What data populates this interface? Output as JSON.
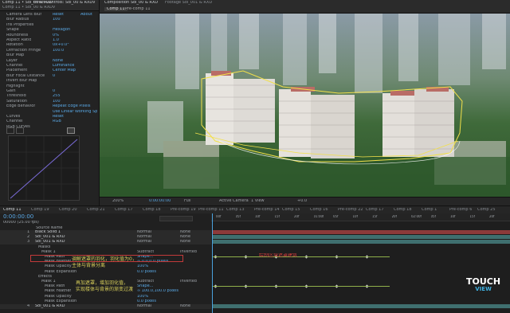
{
  "effect_controls": {
    "tabs": [
      "Comp 11 • Sol_00 & RXD",
      "Effect Controls: Sol_00 & RXDV"
    ],
    "header": "Comp 11 • Sol_00 & RXDV",
    "rows": [
      {
        "label": "Camera Lens Blur",
        "value": "Reset"
      },
      {
        "label": "Blur Radius",
        "value": "100"
      },
      {
        "label": "Iris Properties",
        "value": ""
      },
      {
        "label": "Shape",
        "value": "Hexagon"
      },
      {
        "label": "Roundness",
        "value": "0%"
      },
      {
        "label": "Aspect Ratio",
        "value": "1.0"
      },
      {
        "label": "Rotation",
        "value": "0x+0.0°"
      },
      {
        "label": "Diffraction Fringe",
        "value": "100.0"
      },
      {
        "label": "Blur Map",
        "value": ""
      },
      {
        "label": "Layer",
        "value": "None"
      },
      {
        "label": "Channel",
        "value": "Luminance"
      },
      {
        "label": "Placement",
        "value": "Center Map"
      },
      {
        "label": "Blur Focal Distance",
        "value": "0"
      },
      {
        "label": "Invert Blur Map",
        "value": ""
      },
      {
        "label": "Highlight",
        "value": ""
      },
      {
        "label": "Gain",
        "value": "0"
      },
      {
        "label": "Threshold",
        "value": "255"
      },
      {
        "label": "Saturation",
        "value": "100"
      },
      {
        "label": "Edge Behavior",
        "value": "Repeat Edge Pixels"
      },
      {
        "label": "",
        "value": "Use Linear Working Sp"
      },
      {
        "label": "Curves",
        "value": "Reset"
      },
      {
        "label": "Channel",
        "value": "RGB"
      },
      {
        "label": "RGB Curves",
        "value": ""
      }
    ],
    "about": "About"
  },
  "viewer": {
    "tabs": [
      "Composition Sol_00 & RXD",
      "Footage Sol_001 & RXD"
    ],
    "breadcrumb": [
      "Comp 11",
      "Pre-comp 11"
    ],
    "zoom": "200%",
    "timecode": "0:00:00:00",
    "resolution": "Full",
    "camera": "Active Camera",
    "views": "1 View",
    "exposure": "+0.0"
  },
  "timeline": {
    "tabs": [
      "Comp 11",
      "Comp 19",
      "Comp 20",
      "Comp 21",
      "Comp 17",
      "Comp 18",
      "Pre-comp 19",
      "Pre-comp 11",
      "Comp 13",
      "Pre-comp 14",
      "Comp 15",
      "Comp 16",
      "Pre-comp 22",
      "Comp 17",
      "Comp 18",
      "Comp 1",
      "Pre-comp 6",
      "Comp 25"
    ],
    "timecode": "0:00:00:00",
    "fps": "00000 (25.00 fps)",
    "column_header": "Source Name",
    "layers": [
      {
        "num": "1",
        "name": "Black Solid 1",
        "mode": "Normal",
        "parent": "None",
        "indent": 0
      },
      {
        "num": "2",
        "name": "Sol_001 & RXD",
        "mode": "Normal",
        "parent": "None",
        "indent": 0
      },
      {
        "num": "3",
        "name": "Sol_001 & RXD",
        "mode": "Normal",
        "parent": "None",
        "indent": 0
      },
      {
        "num": "",
        "name": "Masks",
        "mode": "",
        "parent": "",
        "indent": 1
      },
      {
        "num": "",
        "name": "Mask 1",
        "mode": "Subtract",
        "parent": "Inverted",
        "indent": 2
      },
      {
        "num": "",
        "name": "Mask Path",
        "mode": "Shape...",
        "parent": "",
        "indent": 3
      },
      {
        "num": "",
        "name": "Mask Feather",
        "mode": "∞ 0.0,0.0 pixels",
        "parent": "",
        "indent": 3
      },
      {
        "num": "",
        "name": "Mask Opacity",
        "mode": "100%",
        "parent": "",
        "indent": 3
      },
      {
        "num": "",
        "name": "Mask Expansion",
        "mode": "0.0 pixels",
        "parent": "",
        "indent": 3
      },
      {
        "num": "",
        "name": "Effects",
        "mode": "",
        "parent": "",
        "indent": 1
      },
      {
        "num": "",
        "name": "Mask 1",
        "mode": "Subtract",
        "parent": "Inverted",
        "indent": 2
      },
      {
        "num": "",
        "name": "Mask Path",
        "mode": "Shape...",
        "parent": "",
        "indent": 3
      },
      {
        "num": "",
        "name": "Mask Feather",
        "mode": "∞ 100.0,100.0 pixels",
        "parent": "",
        "indent": 3
      },
      {
        "num": "",
        "name": "Mask Opacity",
        "mode": "100%",
        "parent": "",
        "indent": 3
      },
      {
        "num": "",
        "name": "Mask Expansion",
        "mode": "0.0 pixels",
        "parent": "",
        "indent": 3
      },
      {
        "num": "4",
        "name": "Sol_001 & RXD",
        "mode": "Normal",
        "parent": "None",
        "indent": 0
      }
    ],
    "annotations": [
      "调解遮罩的羽化，羽化值为0，",
      "主体与背景分离",
      "再加遮罩，增加羽化值，",
      "实现楼体与背景的渐变过渡"
    ],
    "red_note": "绘制区域遮罩建筑",
    "ruler": [
      "00f",
      "05f",
      "10f",
      "15f",
      "20f",
      "01:00f",
      "05f",
      "10f",
      "15f",
      "20f",
      "02:00f",
      "05f",
      "10f",
      "15f",
      "20f"
    ]
  },
  "watermark": {
    "line1": "TOUCH",
    "line2": "VIEW"
  }
}
